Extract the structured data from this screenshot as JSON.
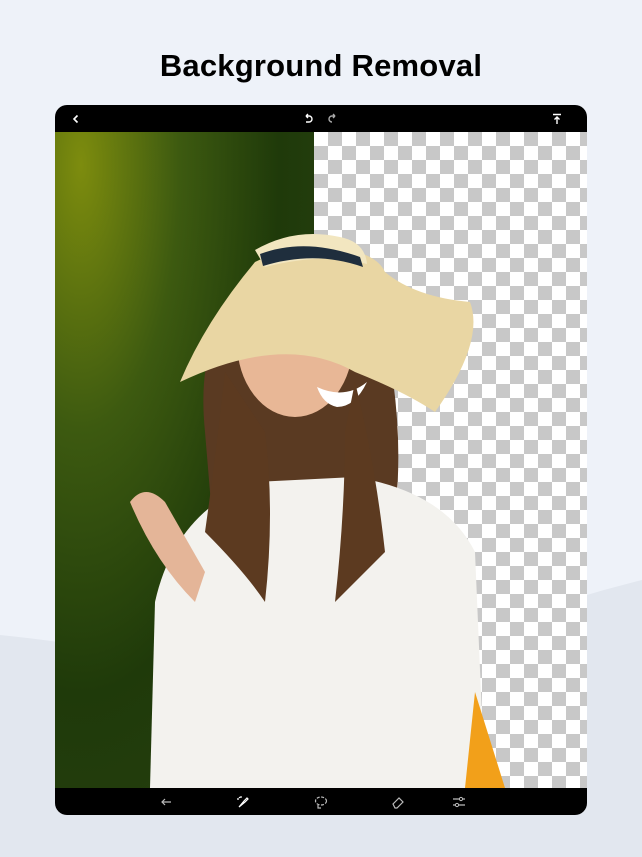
{
  "title": "Background Removal",
  "top_toolbar": {
    "icons": [
      "back-chevron-icon",
      "undo-icon",
      "redo-icon",
      "export-icon"
    ]
  },
  "bottom_toolbar": {
    "icons": [
      "back-arrow-icon",
      "magic-brush-icon",
      "lasso-icon",
      "eraser-icon",
      "adjust-sliders-icon"
    ]
  },
  "colors": {
    "background": "#eef2f9",
    "device": "#000000",
    "checker": "#c8c8c8"
  }
}
